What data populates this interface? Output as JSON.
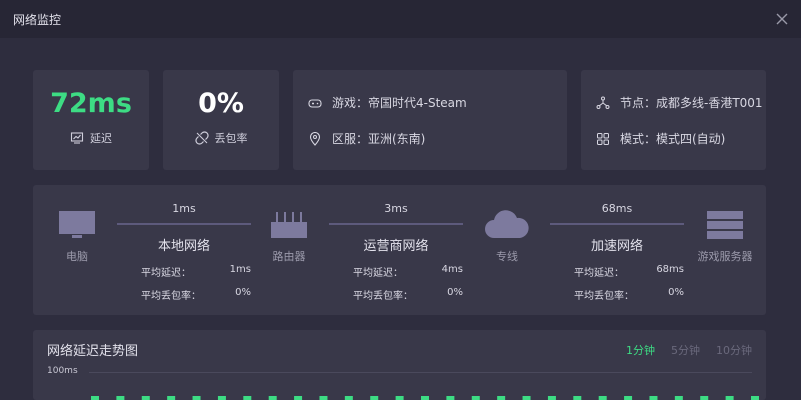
{
  "window": {
    "title": "网络监控"
  },
  "stats": {
    "latency": {
      "value": "72ms",
      "label": "延迟",
      "color": "#3ddc84"
    },
    "loss": {
      "value": "0%",
      "label": "丢包率",
      "color": "#ffffff"
    }
  },
  "game_info": {
    "game": "游戏：帝国时代4-Steam",
    "region": "区服：亚洲(东南)"
  },
  "node_info": {
    "node": "节点：成都多线-香港T001",
    "mode": "模式：模式四(自动)"
  },
  "path": {
    "nodes": [
      {
        "label": "电脑",
        "icon": "monitor-icon"
      },
      {
        "label": "路由器",
        "icon": "router-icon"
      },
      {
        "label": "专线",
        "icon": "cloud-icon"
      },
      {
        "label": "游戏服务器",
        "icon": "server-icon"
      }
    ],
    "segments": [
      {
        "ms": "1ms",
        "name": "本地网络",
        "avg_latency_label": "平均延迟：",
        "avg_latency": "1ms",
        "avg_loss_label": "平均丢包率：",
        "avg_loss": "0%"
      },
      {
        "ms": "3ms",
        "name": "运营商网络",
        "avg_latency_label": "平均延迟：",
        "avg_latency": "4ms",
        "avg_loss_label": "平均丢包率：",
        "avg_loss": "0%"
      },
      {
        "ms": "68ms",
        "name": "加速网络",
        "avg_latency_label": "平均延迟：",
        "avg_latency": "68ms",
        "avg_loss_label": "平均丢包率：",
        "avg_loss": "0%"
      }
    ]
  },
  "trend": {
    "title": "网络延迟走势图",
    "tabs": [
      "1分钟",
      "5分钟",
      "10分钟"
    ],
    "active_tab": 0,
    "y_label": "100ms"
  },
  "chart_data": {
    "type": "bar",
    "ylim": [
      0,
      100
    ],
    "bar_count": 27,
    "color": "#3ddc84"
  },
  "colors": {
    "accent": "#3ddc84",
    "panel": "#393849",
    "background": "#2e2d3e"
  }
}
